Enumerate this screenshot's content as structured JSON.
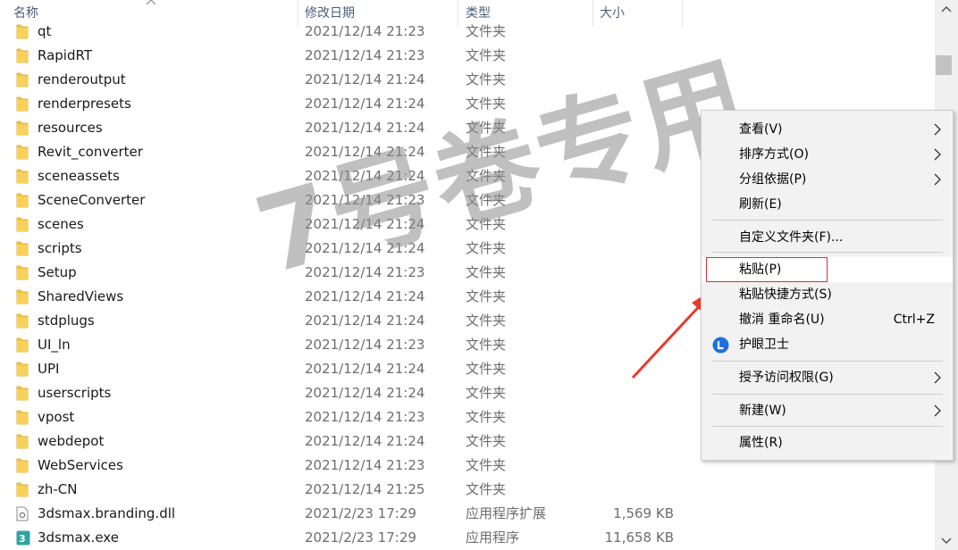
{
  "header": {
    "name": "名称",
    "date": "修改日期",
    "type": "类型",
    "size": "大小"
  },
  "rows": [
    {
      "name": "qt",
      "date": "2021/12/14 21:23",
      "type": "文件夹",
      "size": "",
      "icon": "folder-icon"
    },
    {
      "name": "RapidRT",
      "date": "2021/12/14 21:23",
      "type": "文件夹",
      "size": "",
      "icon": "folder-icon"
    },
    {
      "name": "renderoutput",
      "date": "2021/12/14 21:24",
      "type": "文件夹",
      "size": "",
      "icon": "folder-icon"
    },
    {
      "name": "renderpresets",
      "date": "2021/12/14 21:24",
      "type": "文件夹",
      "size": "",
      "icon": "folder-icon"
    },
    {
      "name": "resources",
      "date": "2021/12/14 21:24",
      "type": "文件夹",
      "size": "",
      "icon": "folder-icon"
    },
    {
      "name": "Revit_converter",
      "date": "2021/12/14 21:24",
      "type": "文件夹",
      "size": "",
      "icon": "folder-icon"
    },
    {
      "name": "sceneassets",
      "date": "2021/12/14 21:24",
      "type": "文件夹",
      "size": "",
      "icon": "folder-icon"
    },
    {
      "name": "SceneConverter",
      "date": "2021/12/14 21:23",
      "type": "文件夹",
      "size": "",
      "icon": "folder-icon"
    },
    {
      "name": "scenes",
      "date": "2021/12/14 21:24",
      "type": "文件夹",
      "size": "",
      "icon": "folder-icon"
    },
    {
      "name": "scripts",
      "date": "2021/12/14 21:24",
      "type": "文件夹",
      "size": "",
      "icon": "folder-icon"
    },
    {
      "name": "Setup",
      "date": "2021/12/14 21:23",
      "type": "文件夹",
      "size": "",
      "icon": "folder-icon"
    },
    {
      "name": "SharedViews",
      "date": "2021/12/14 21:24",
      "type": "文件夹",
      "size": "",
      "icon": "folder-icon"
    },
    {
      "name": "stdplugs",
      "date": "2021/12/14 21:24",
      "type": "文件夹",
      "size": "",
      "icon": "folder-icon"
    },
    {
      "name": "UI_ln",
      "date": "2021/12/14 21:23",
      "type": "文件夹",
      "size": "",
      "icon": "folder-icon"
    },
    {
      "name": "UPI",
      "date": "2021/12/14 21:24",
      "type": "文件夹",
      "size": "",
      "icon": "folder-icon"
    },
    {
      "name": "userscripts",
      "date": "2021/12/14 21:24",
      "type": "文件夹",
      "size": "",
      "icon": "folder-icon"
    },
    {
      "name": "vpost",
      "date": "2021/12/14 21:23",
      "type": "文件夹",
      "size": "",
      "icon": "folder-icon"
    },
    {
      "name": "webdepot",
      "date": "2021/12/14 21:24",
      "type": "文件夹",
      "size": "",
      "icon": "folder-icon"
    },
    {
      "name": "WebServices",
      "date": "2021/12/14 21:23",
      "type": "文件夹",
      "size": "",
      "icon": "folder-icon"
    },
    {
      "name": "zh-CN",
      "date": "2021/12/14 21:25",
      "type": "文件夹",
      "size": "",
      "icon": "folder-icon"
    },
    {
      "name": "3dsmax.branding.dll",
      "date": "2021/2/23 17:29",
      "type": "应用程序扩展",
      "size": "1,569 KB",
      "icon": "dll-file-icon"
    },
    {
      "name": "3dsmax.exe",
      "date": "2021/2/23 17:29",
      "type": "应用程序",
      "size": "11,658 KB",
      "icon": "3dsmax-app-icon"
    }
  ],
  "watermark": "7号卷专用",
  "context_menu": {
    "items": [
      {
        "label": "查看(V)",
        "submenu": true
      },
      {
        "label": "排序方式(O)",
        "submenu": true
      },
      {
        "label": "分组依据(P)",
        "submenu": true
      },
      {
        "label": "刷新(E)"
      },
      {
        "label": "自定义文件夹(F)..."
      },
      {
        "label": "粘贴(P)",
        "highlighted": true
      },
      {
        "label": "粘贴快捷方式(S)"
      },
      {
        "label": "撤消 重命名(U)",
        "shortcut": "Ctrl+Z"
      },
      {
        "label": "护眼卫士",
        "icon": "eye-guard-icon"
      },
      {
        "label": "授予访问权限(G)",
        "submenu": true
      },
      {
        "label": "新建(W)",
        "submenu": true
      },
      {
        "label": "属性(R)"
      }
    ]
  },
  "colors": {
    "header_text": "#4c607a",
    "folder": "#f5c542",
    "highlight_box": "#e03030",
    "arrow": "#e83a2f",
    "eye_guard_blue": "#1e6fe0"
  }
}
